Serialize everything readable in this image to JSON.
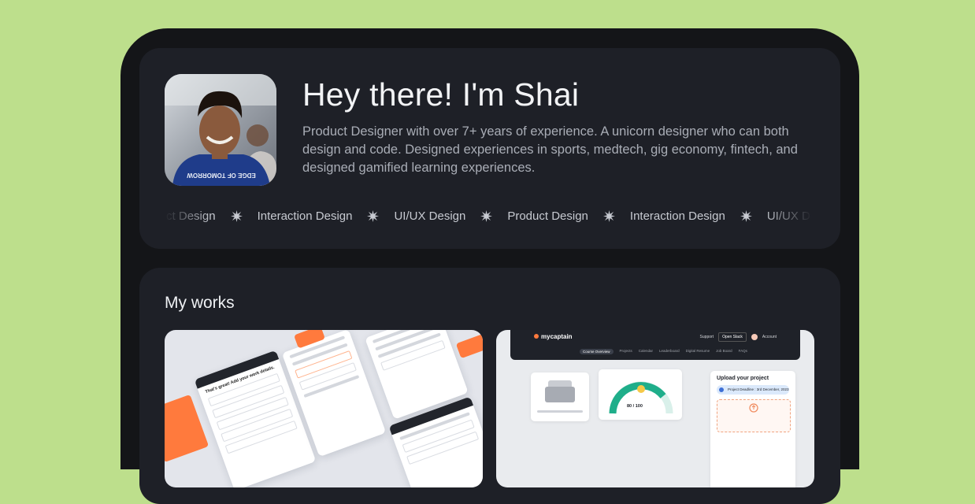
{
  "profile": {
    "title": "Hey there! I'm Shai",
    "bio": "Product Designer with over 7+ years of experience. A unicorn designer who can both design and code. Designed experiences in sports, medtech, gig economy, fintech, and designed gamified learning experiences.",
    "avatar_shirt_text": "EDGE OF TOMORROW"
  },
  "skills": [
    "Product Design",
    "Interaction Design",
    "UI/UX Design",
    "Product Design",
    "Interaction Design",
    "UI/UX Design"
  ],
  "skill_icon": "sparkle-icon",
  "works": {
    "title": "My works",
    "items": [
      {
        "mockup_heading": "That's great! Add your work details."
      },
      {
        "brand": "mycaptain",
        "nav": {
          "support": "Support",
          "button": "Open Slack",
          "account": "Account"
        },
        "tabs": [
          "Course Overview",
          "Projects",
          "Calendar",
          "Leaderboard",
          "Digital Resume",
          "Job Board",
          "FAQs"
        ],
        "score": "80 / 100",
        "upload_title": "Upload your project",
        "deadline": "Project Deadline : 3rd December, 2023"
      }
    ]
  },
  "colors": {
    "page_bg": "#bddf8c",
    "device_bg": "#141518",
    "card_bg": "#1e2027",
    "accent": "#ff7a3d"
  }
}
